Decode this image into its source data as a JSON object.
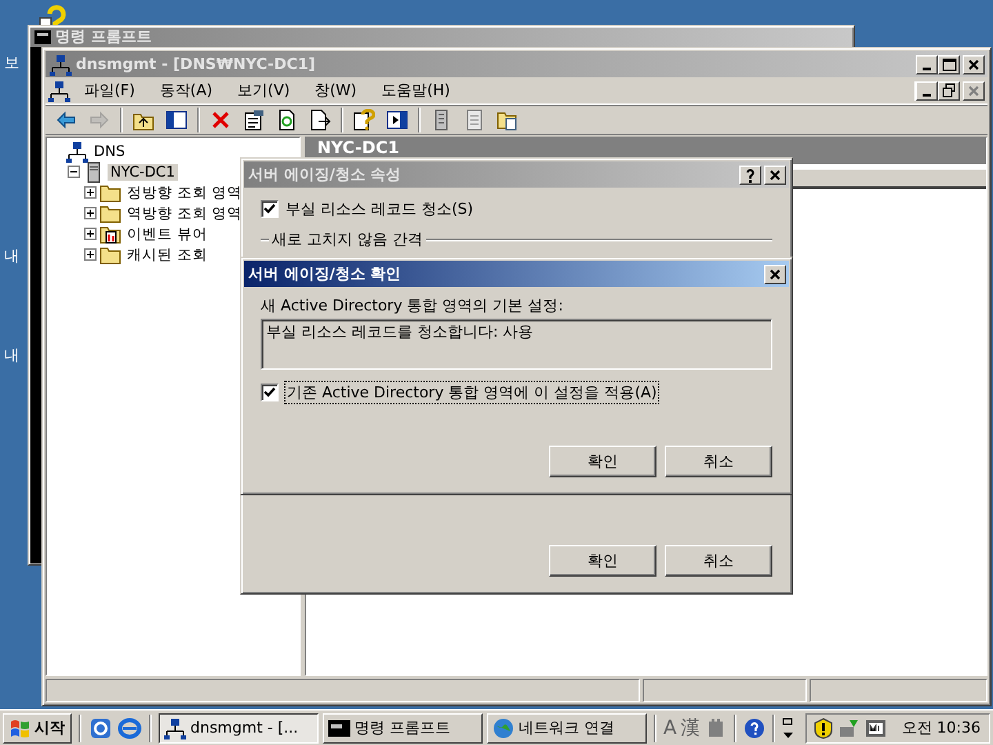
{
  "desktop": {
    "icons": [
      {
        "label": "보"
      },
      {
        "label": "내"
      },
      {
        "label": "내"
      }
    ]
  },
  "background_window": {
    "title": "명령 프롬프트"
  },
  "main_window": {
    "title": "dnsmgmt - [DNS₩NYC-DC1]",
    "active": false,
    "menu": [
      "파일(F)",
      "동작(A)",
      "보기(V)",
      "창(W)",
      "도움말(H)"
    ],
    "toolbar": [
      {
        "kind": "back",
        "disabled": false
      },
      {
        "kind": "forward",
        "disabled": true
      },
      {
        "kind": "separator"
      },
      {
        "kind": "up",
        "disabled": false
      },
      {
        "kind": "pane",
        "disabled": false
      },
      {
        "kind": "separator"
      },
      {
        "kind": "delete",
        "disabled": false
      },
      {
        "kind": "properties",
        "disabled": false
      },
      {
        "kind": "refresh",
        "disabled": false
      },
      {
        "kind": "export",
        "disabled": false
      },
      {
        "kind": "separator"
      },
      {
        "kind": "help",
        "disabled": false
      },
      {
        "kind": "pane2",
        "disabled": false
      },
      {
        "kind": "separator"
      },
      {
        "kind": "list",
        "disabled": false
      },
      {
        "kind": "sheet",
        "disabled": false
      },
      {
        "kind": "folder",
        "disabled": false
      }
    ],
    "tree": [
      {
        "label": "DNS",
        "kind": "dns",
        "selected": false,
        "children": [
          {
            "label": "NYC-DC1",
            "kind": "server",
            "selected": true,
            "expanded": true,
            "children": [
              {
                "label": "정방향 조회 영역",
                "kind": "folder",
                "selected": false,
                "expanded": false
              },
              {
                "label": "역방향 조회 영역",
                "kind": "folder",
                "selected": false,
                "expanded": false
              },
              {
                "label": "이벤트 뷰어",
                "kind": "events",
                "selected": false,
                "expanded": false
              },
              {
                "label": "캐시된 조회",
                "kind": "folder",
                "selected": false,
                "expanded": false
              }
            ]
          }
        ]
      }
    ],
    "details": {
      "header": "NYC-DC1"
    }
  },
  "properties_dialog": {
    "title": "서버 에이징/청소 속성",
    "active": false,
    "checkbox": {
      "label": "부실 리소스 레코드 청소(S)",
      "checked": true
    },
    "group_label": "새로 고치지 않음 간격",
    "buttons": [
      "확인",
      "취소"
    ]
  },
  "confirm_dialog": {
    "title": "서버 에이징/청소 확인",
    "active": true,
    "label": "새 Active Directory 통합 영역의 기본 설정:",
    "summary": "부실 리소스 레코드를 청소합니다: 사용",
    "checkbox": {
      "label": "기존 Active Directory 통합 영역에 이 설정을 적용(A)",
      "checked": true,
      "focused": true
    },
    "buttons": [
      "확인",
      "취소"
    ]
  },
  "taskbar": {
    "start": "시작",
    "tasks": [
      {
        "label": "dnsmgmt - [...",
        "kind": "dns",
        "selected": true
      },
      {
        "label": "명령 프롬프트",
        "kind": "console",
        "selected": false
      },
      {
        "label": "네트워크 연결",
        "kind": "network",
        "selected": false
      }
    ],
    "language": [
      "A",
      "漢"
    ],
    "clock": "오전 10:36"
  }
}
